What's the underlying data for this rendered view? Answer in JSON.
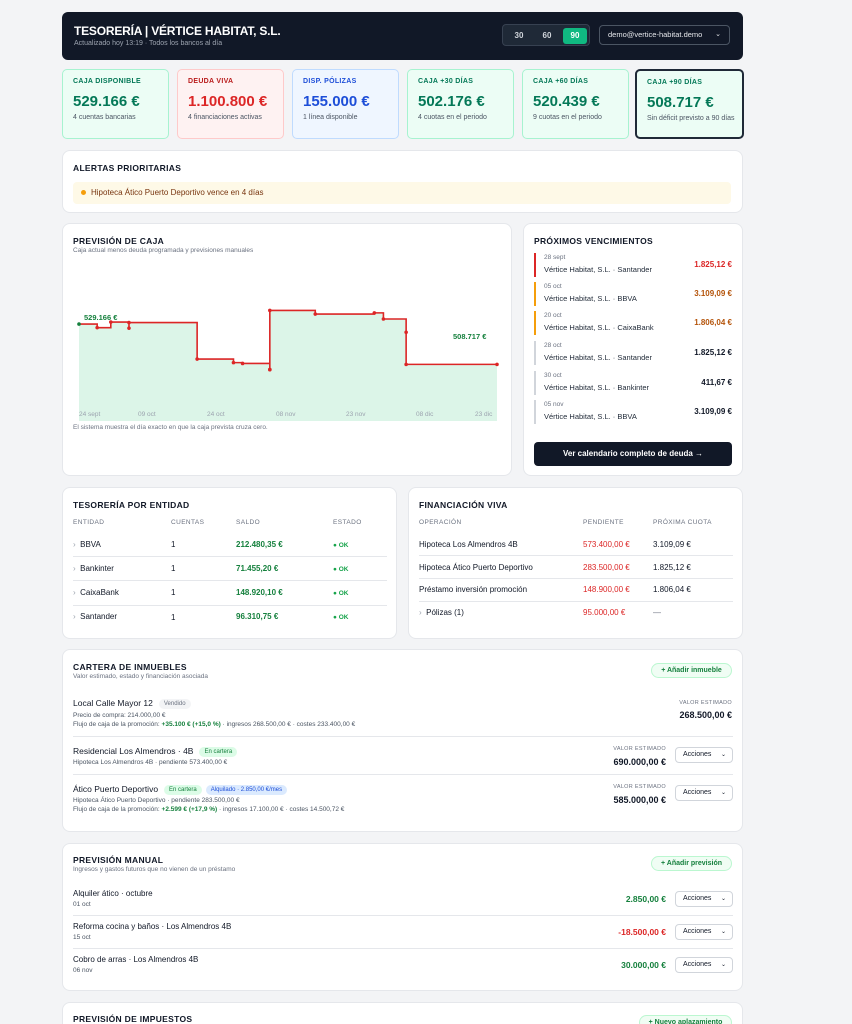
{
  "header": {
    "title": "TESORERÍA | VÉRTICE HABITAT, S.L.",
    "subtitle": "Actualizado hoy 13:19 · Todos los bancos al día",
    "ranges": [
      "30",
      "60",
      "90"
    ],
    "active_range": "90",
    "user": "demo@vertice-habitat.demo"
  },
  "kpis": [
    {
      "label": "CAJA DISPONIBLE",
      "value": "529.166 €",
      "desc": "4 cuentas bancarias"
    },
    {
      "label": "DEUDA VIVA",
      "value": "1.100.800 €",
      "desc": "4 financiaciones activas"
    },
    {
      "label": "DISP. PÓLIZAS",
      "value": "155.000 €",
      "desc": "1 línea disponible"
    },
    {
      "label": "CAJA +30 DÍAS",
      "value": "502.176 €",
      "desc": "4 cuotas en el periodo"
    },
    {
      "label": "CAJA +60 DÍAS",
      "value": "520.439 €",
      "desc": "9 cuotas en el periodo"
    },
    {
      "label": "CAJA +90 DÍAS",
      "value": "508.717 €",
      "desc": "Sin déficit previsto a 90 días"
    }
  ],
  "alerts": {
    "title": "ALERTAS PRIORITARIAS",
    "items": [
      "Hipoteca Ático Puerto Deportivo vence en 4 días"
    ]
  },
  "forecast": {
    "title": "PREVISIÓN DE CAJA",
    "subtitle": "Caja actual menos deuda programada y previsiones manuales",
    "start_label": "529.166 €",
    "end_label": "508.717 €",
    "x_ticks": [
      "24 sept",
      "09 oct",
      "24 oct",
      "08 nov",
      "23 nov",
      "08 dic",
      "23 dic"
    ],
    "note": "El sistema muestra el día exacto en que la caja prevista cruza cero."
  },
  "chart_data": {
    "type": "area",
    "title": "PREVISIÓN DE CAJA",
    "xlabel": "",
    "ylabel": "",
    "x": [
      "24 sept",
      "28 sept",
      "01 oct",
      "05 oct",
      "05 oct",
      "20 oct",
      "28 oct",
      "30 oct",
      "05 nov",
      "05 nov",
      "05 nov",
      "15 nov",
      "28 nov",
      "30 nov",
      "05 dic",
      "05 dic",
      "25 dic"
    ],
    "values": [
      529166,
      527341,
      530191,
      527082,
      529932,
      511432,
      509606,
      509194,
      506085,
      506085,
      536085,
      534260,
      534848,
      531739,
      525000,
      508717,
      508717
    ]
  },
  "upcoming": {
    "title": "PRÓXIMOS VENCIMIENTOS",
    "items": [
      {
        "date": "28 sept",
        "name": "Vértice Habitat, S.L. · Santander",
        "amount": "1.825,12 €"
      },
      {
        "date": "05 oct",
        "name": "Vértice Habitat, S.L. · BBVA",
        "amount": "3.109,09 €"
      },
      {
        "date": "20 oct",
        "name": "Vértice Habitat, S.L. · CaixaBank",
        "amount": "1.806,04 €"
      },
      {
        "date": "28 oct",
        "name": "Vértice Habitat, S.L. · Santander",
        "amount": "1.825,12 €"
      },
      {
        "date": "30 oct",
        "name": "Vértice Habitat, S.L. · Bankinter",
        "amount": "411,67 €"
      },
      {
        "date": "05 nov",
        "name": "Vértice Habitat, S.L. · BBVA",
        "amount": "3.109,09 €"
      }
    ],
    "button": "Ver calendario completo de deuda →"
  },
  "entities": {
    "title": "TESORERÍA POR ENTIDAD",
    "headers": [
      "ENTIDAD",
      "CUENTAS",
      "SALDO",
      "ESTADO"
    ],
    "rows": [
      {
        "name": "BBVA",
        "accounts": "1",
        "balance": "212.480,35 €",
        "status": "● OK"
      },
      {
        "name": "Bankinter",
        "accounts": "1",
        "balance": "71.455,20 €",
        "status": "● OK"
      },
      {
        "name": "CaixaBank",
        "accounts": "1",
        "balance": "148.920,10 €",
        "status": "● OK"
      },
      {
        "name": "Santander",
        "accounts": "1",
        "balance": "96.310,75 €",
        "status": "● OK"
      }
    ]
  },
  "financing": {
    "title": "FINANCIACIÓN VIVA",
    "headers": [
      "OPERACIÓN",
      "PENDIENTE",
      "PRÓXIMA CUOTA"
    ],
    "rows": [
      {
        "name": "Hipoteca Los Almendros 4B",
        "pending": "573.400,00 €",
        "next": "3.109,09 €"
      },
      {
        "name": "Hipoteca Ático Puerto Deportivo",
        "pending": "283.500,00 €",
        "next": "1.825,12 €"
      },
      {
        "name": "Préstamo inversión promoción",
        "pending": "148.900,00 €",
        "next": "1.806,04 €"
      },
      {
        "name": "Pólizas (1)",
        "pending": "95.000,00 €",
        "next": "—"
      }
    ]
  },
  "portfolio": {
    "title": "CARTERA DE INMUEBLES",
    "subtitle": "Valor estimado, estado y financiación asociada",
    "add": "+ Añadir inmueble",
    "value_caption": "VALOR ESTIMADO",
    "actions": "Acciones",
    "items": [
      {
        "name": "Local Calle Mayor 12",
        "tag": "Vendido",
        "line1": "Precio de compra: 214.000,00 €",
        "line2a": "Flujo de caja de la promoción: ",
        "line2b": "+35.100 € (+15,0 %)",
        "line2c": " · ingresos 268.500,00 € · costes 233.400,00 €",
        "value": "268.500,00 €"
      },
      {
        "name": "Residencial Los Almendros · 4B",
        "tag": "En cartera",
        "line1": "Hipoteca Los Almendros 4B · pendiente 573.400,00 €",
        "value": "690.000,00 €"
      },
      {
        "name": "Ático Puerto Deportivo",
        "tag": "En cartera",
        "tag2": "Alquilado · 2.850,00 €/mes",
        "line1": "Hipoteca Ático Puerto Deportivo · pendiente 283.500,00 €",
        "line2a": "Flujo de caja de la promoción: ",
        "line2b": "+2.599 € (+17,9 %)",
        "line2c": " · ingresos 17.100,00 € · costes 14.500,72 €",
        "value": "585.000,00 €"
      }
    ]
  },
  "manual": {
    "title": "PREVISIÓN MANUAL",
    "subtitle": "Ingresos y gastos futuros que no vienen de un préstamo",
    "add": "+ Añadir previsión",
    "actions": "Acciones",
    "items": [
      {
        "name": "Alquiler ático · octubre",
        "date": "01 oct",
        "amount": "2.850,00 €"
      },
      {
        "name": "Reforma cocina y baños · Los Almendros 4B",
        "date": "15 oct",
        "amount": "-18.500,00 €"
      },
      {
        "name": "Cobro de arras · Los Almendros 4B",
        "date": "06 nov",
        "amount": "30.000,00 €"
      }
    ]
  },
  "taxes": {
    "title": "PREVISIÓN DE IMPUESTOS",
    "add": "+ Nuevo aplazamiento"
  },
  "colors": {
    "accent": "#10b981",
    "danger": "#dc2626",
    "warning": "#d97706",
    "dark": "#111827"
  }
}
